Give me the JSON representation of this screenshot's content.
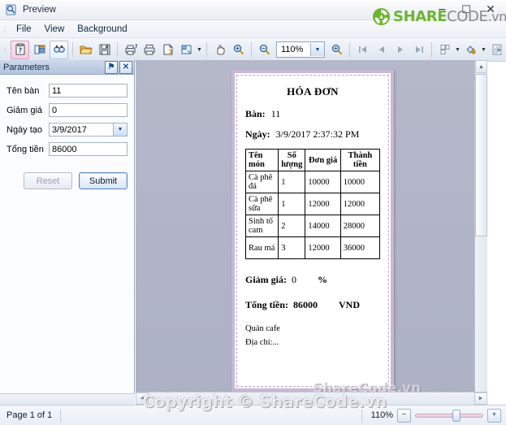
{
  "window": {
    "title": "Preview",
    "icon": "preview-icon",
    "controls": {
      "minimize": "─",
      "maximize": "☐",
      "close": "✕"
    }
  },
  "brand": {
    "share": "SHARE",
    "code": "CODE",
    "vn": ".vn"
  },
  "menu": {
    "items": [
      {
        "label": "File"
      },
      {
        "label": "View"
      },
      {
        "label": "Background"
      }
    ]
  },
  "toolbar": {
    "buttons": [
      {
        "name": "report-parameters-icon",
        "tooltip": "Parameters"
      },
      {
        "name": "document-map-icon",
        "tooltip": "Document Map"
      },
      {
        "name": "search-binoculars-icon",
        "tooltip": "Find"
      },
      {
        "name": "open-folder-icon",
        "tooltip": "Open"
      },
      {
        "name": "save-disk-icon",
        "tooltip": "Save"
      },
      {
        "name": "print-preview-icon",
        "tooltip": "Print Preview"
      },
      {
        "name": "print-icon",
        "tooltip": "Print"
      },
      {
        "name": "page-setup-icon",
        "tooltip": "Page Setup"
      },
      {
        "name": "scale-icon",
        "tooltip": "Scale"
      },
      {
        "name": "hand-tool-icon",
        "tooltip": "Hand Tool"
      },
      {
        "name": "zoom-in-icon",
        "tooltip": "Zoom In"
      },
      {
        "name": "zoom-out-icon",
        "tooltip": "Zoom Out"
      },
      {
        "name": "first-page-icon",
        "tooltip": "First Page"
      },
      {
        "name": "previous-page-icon",
        "tooltip": "Previous Page"
      },
      {
        "name": "next-page-icon",
        "tooltip": "Next Page"
      },
      {
        "name": "last-page-icon",
        "tooltip": "Last Page"
      },
      {
        "name": "multiple-pages-icon",
        "tooltip": "Multiple Pages"
      },
      {
        "name": "background-color-icon",
        "tooltip": "Background Color"
      },
      {
        "name": "watermark-icon",
        "tooltip": "Watermark"
      }
    ],
    "zoom_value": "110%",
    "overflow": "»"
  },
  "parameters_panel": {
    "title": "Parameters",
    "pin_glyph": "⚑",
    "close_glyph": "✕",
    "fields": [
      {
        "label": "Tên bàn",
        "value": "11",
        "type": "text"
      },
      {
        "label": "Giảm giá",
        "value": "0",
        "type": "text"
      },
      {
        "label": "Ngày tạo",
        "value": "3/9/2017",
        "type": "date"
      },
      {
        "label": "Tổng tiền",
        "value": "86000",
        "type": "text"
      }
    ],
    "reset_label": "Reset",
    "submit_label": "Submit"
  },
  "invoice": {
    "title": "HÓA ĐƠN",
    "table_label": "Bàn:",
    "table_value": "11",
    "date_label": "Ngày:",
    "date_value": "3/9/2017 2:37:32 PM",
    "columns": [
      "Tên món",
      "Số lượng",
      "Đơn giá",
      "Thành tiền"
    ],
    "rows": [
      {
        "name": "Cà phê đá",
        "qty": "1",
        "price": "10000",
        "total": "10000"
      },
      {
        "name": "Cà phê sữa",
        "qty": "1",
        "price": "12000",
        "total": "12000"
      },
      {
        "name": "Sinh tố cam",
        "qty": "2",
        "price": "14000",
        "total": "28000"
      },
      {
        "name": "Rau má",
        "qty": "3",
        "price": "12000",
        "total": "36000"
      }
    ],
    "discount_label": "Giảm giá:",
    "discount_value": "0",
    "discount_unit": "%",
    "total_label": "Tổng tiền:",
    "total_value": "86000",
    "currency": "VND",
    "shop_name": "Quán cafe",
    "address": "Địa chi:..."
  },
  "watermarks": {
    "preview": "ShareCode.vn",
    "copyright": "Copyright © ShareCode.vn"
  },
  "statusbar": {
    "page_text": "Page 1 of 1",
    "zoom_text": "110%",
    "zoom_out_glyph": "−",
    "zoom_in_glyph": "+"
  },
  "colors": {
    "accent_green": "#6db52e",
    "paper_border": "#c9b7d4",
    "workspace_bg": "#b3b6c8",
    "panel_header": "#b4c4dd"
  }
}
